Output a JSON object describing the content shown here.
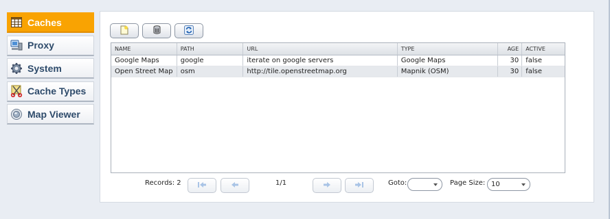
{
  "sidebar": {
    "items": [
      {
        "label": "Caches",
        "icon": "table-icon",
        "active": true
      },
      {
        "label": "Proxy",
        "icon": "server-icon",
        "active": false
      },
      {
        "label": "System",
        "icon": "gear-icon",
        "active": false
      },
      {
        "label": "Cache Types",
        "icon": "scissors-icon",
        "active": false
      },
      {
        "label": "Map Viewer",
        "icon": "globe-icon",
        "active": false
      }
    ]
  },
  "toolbar": {
    "buttons": [
      {
        "icon": "new-icon"
      },
      {
        "icon": "delete-icon"
      },
      {
        "icon": "refresh-icon"
      }
    ]
  },
  "grid": {
    "columns": [
      "NAME",
      "PATH",
      "URL",
      "TYPE",
      "AGE",
      "ACTIVE"
    ],
    "rows": [
      {
        "name": "Google Maps",
        "path": "google",
        "url": "iterate on google servers",
        "type": "Google Maps",
        "age": "30",
        "active": "false"
      },
      {
        "name": "Open Street Map",
        "path": "osm",
        "url": "http://tile.openstreetmap.org",
        "type": "Mapnik (OSM)",
        "age": "30",
        "active": "false"
      }
    ]
  },
  "pager": {
    "records_label": "Records: 2",
    "page": "1/1",
    "goto_label": "Goto:",
    "goto_value": "",
    "page_size_label": "Page Size:",
    "page_size_value": "10"
  },
  "colors": {
    "accent": "#f9a302",
    "nav_text": "#2d4a6a"
  }
}
